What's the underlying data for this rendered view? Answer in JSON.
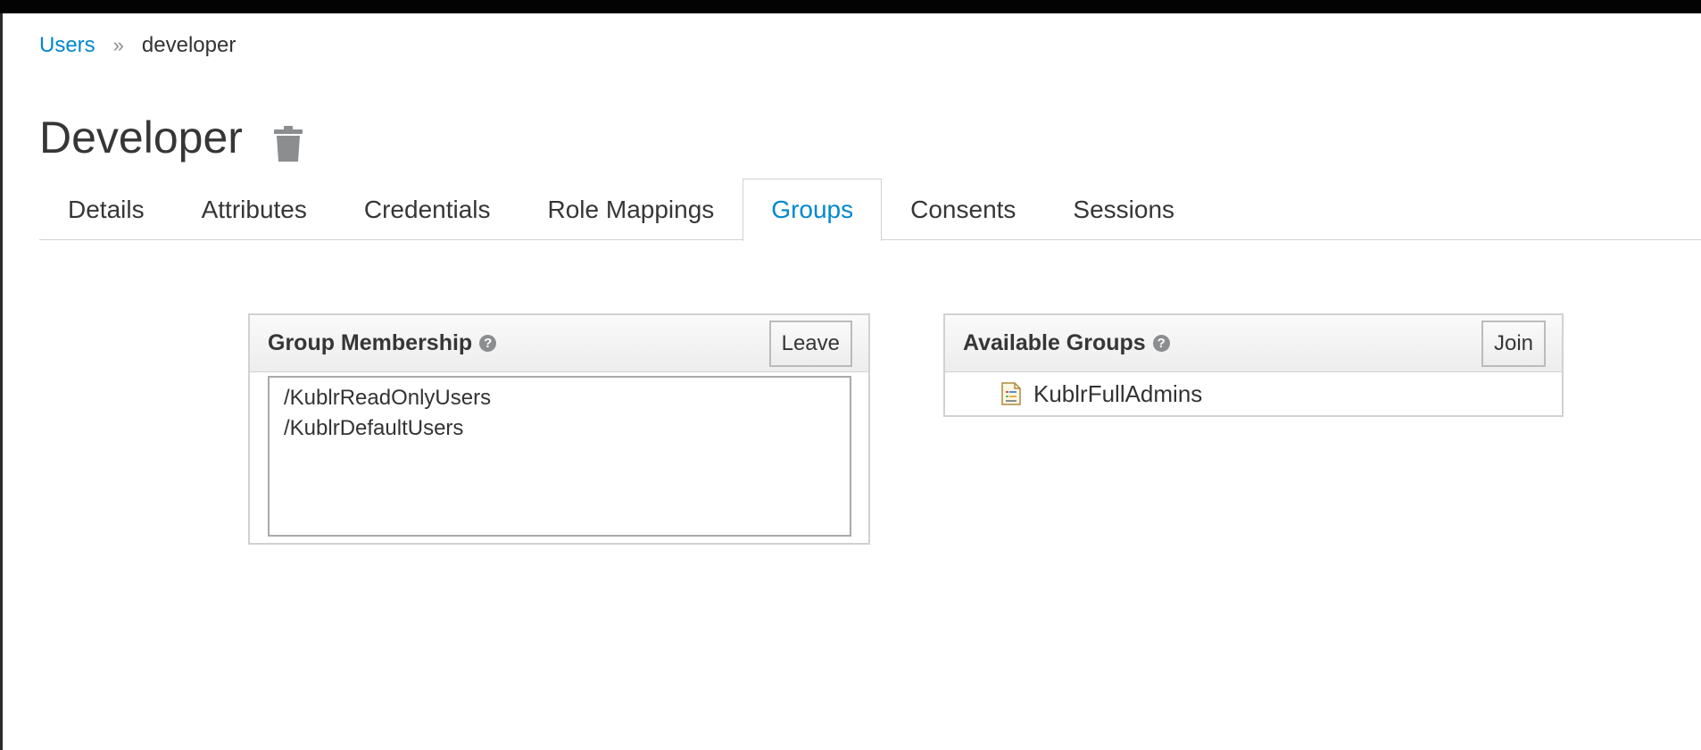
{
  "breadcrumb": {
    "parent": "Users",
    "separator": "»",
    "current": "developer"
  },
  "page": {
    "title": "Developer"
  },
  "tabs": [
    {
      "label": "Details"
    },
    {
      "label": "Attributes"
    },
    {
      "label": "Credentials"
    },
    {
      "label": "Role Mappings"
    },
    {
      "label": "Groups"
    },
    {
      "label": "Consents"
    },
    {
      "label": "Sessions"
    }
  ],
  "active_tab": "Groups",
  "group_membership": {
    "title": "Group Membership",
    "help": "?",
    "leave_label": "Leave",
    "items": [
      "/KublrReadOnlyUsers",
      "/KublrDefaultUsers"
    ]
  },
  "available_groups": {
    "title": "Available Groups",
    "help": "?",
    "join_label": "Join",
    "items": [
      "KublrFullAdmins"
    ]
  },
  "colors": {
    "link": "#0088ce",
    "text": "#363636",
    "border": "#d1d1d1",
    "top_bar": "#030303"
  },
  "icons": {
    "delete": "trash-icon",
    "help": "help-icon",
    "group": "document-icon"
  }
}
